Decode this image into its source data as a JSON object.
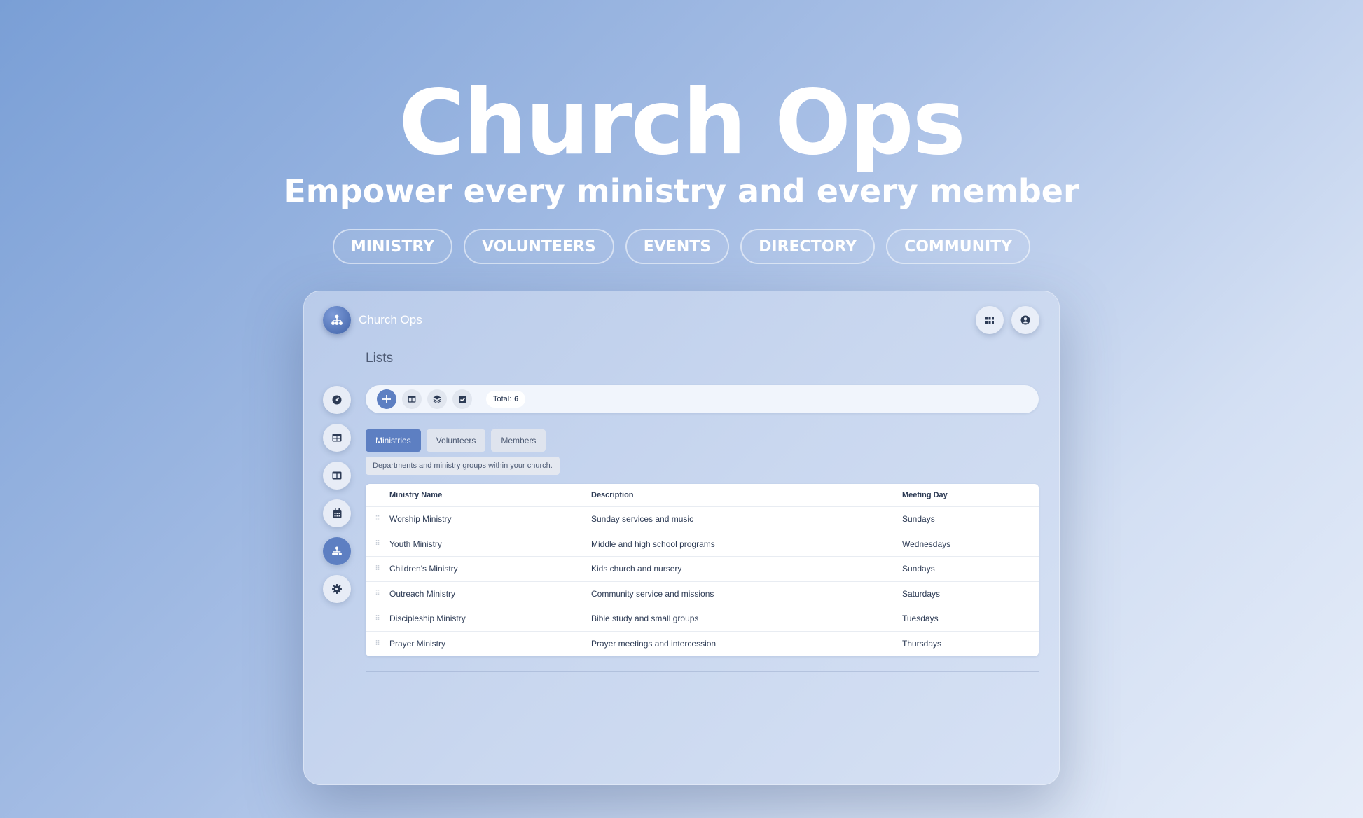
{
  "hero": {
    "title": "Church Ops",
    "subtitle": "Empower every ministry and every member",
    "pills": [
      "MINISTRY",
      "VOLUNTEERS",
      "EVENTS",
      "DIRECTORY",
      "COMMUNITY"
    ]
  },
  "app": {
    "name": "Church Ops",
    "page_title": "Lists",
    "sidebar_icons": [
      "dashboard-icon",
      "table-icon",
      "columns-icon",
      "calendar-icon",
      "ministry-icon",
      "settings-icon"
    ],
    "active_sidebar": "ministry-icon"
  },
  "toolbar": {
    "total_label": "Total:",
    "total_value": "6"
  },
  "tabs": [
    {
      "label": "Ministries",
      "active": true
    },
    {
      "label": "Volunteers",
      "active": false
    },
    {
      "label": "Members",
      "active": false
    }
  ],
  "tab_description": "Departments and ministry groups within your church.",
  "table": {
    "columns": [
      "Ministry Name",
      "Description",
      "Meeting Day"
    ],
    "rows": [
      [
        "Worship Ministry",
        "Sunday services and music",
        "Sundays"
      ],
      [
        "Youth Ministry",
        "Middle and high school programs",
        "Wednesdays"
      ],
      [
        "Children's Ministry",
        "Kids church and nursery",
        "Sundays"
      ],
      [
        "Outreach Ministry",
        "Community service and missions",
        "Saturdays"
      ],
      [
        "Discipleship Ministry",
        "Bible study and small groups",
        "Tuesdays"
      ],
      [
        "Prayer Ministry",
        "Prayer meetings and intercession",
        "Thursdays"
      ]
    ]
  },
  "colors": {
    "accent": "#5d7fc2",
    "background_start": "#7a9fd6",
    "background_end": "#e6edf9"
  }
}
